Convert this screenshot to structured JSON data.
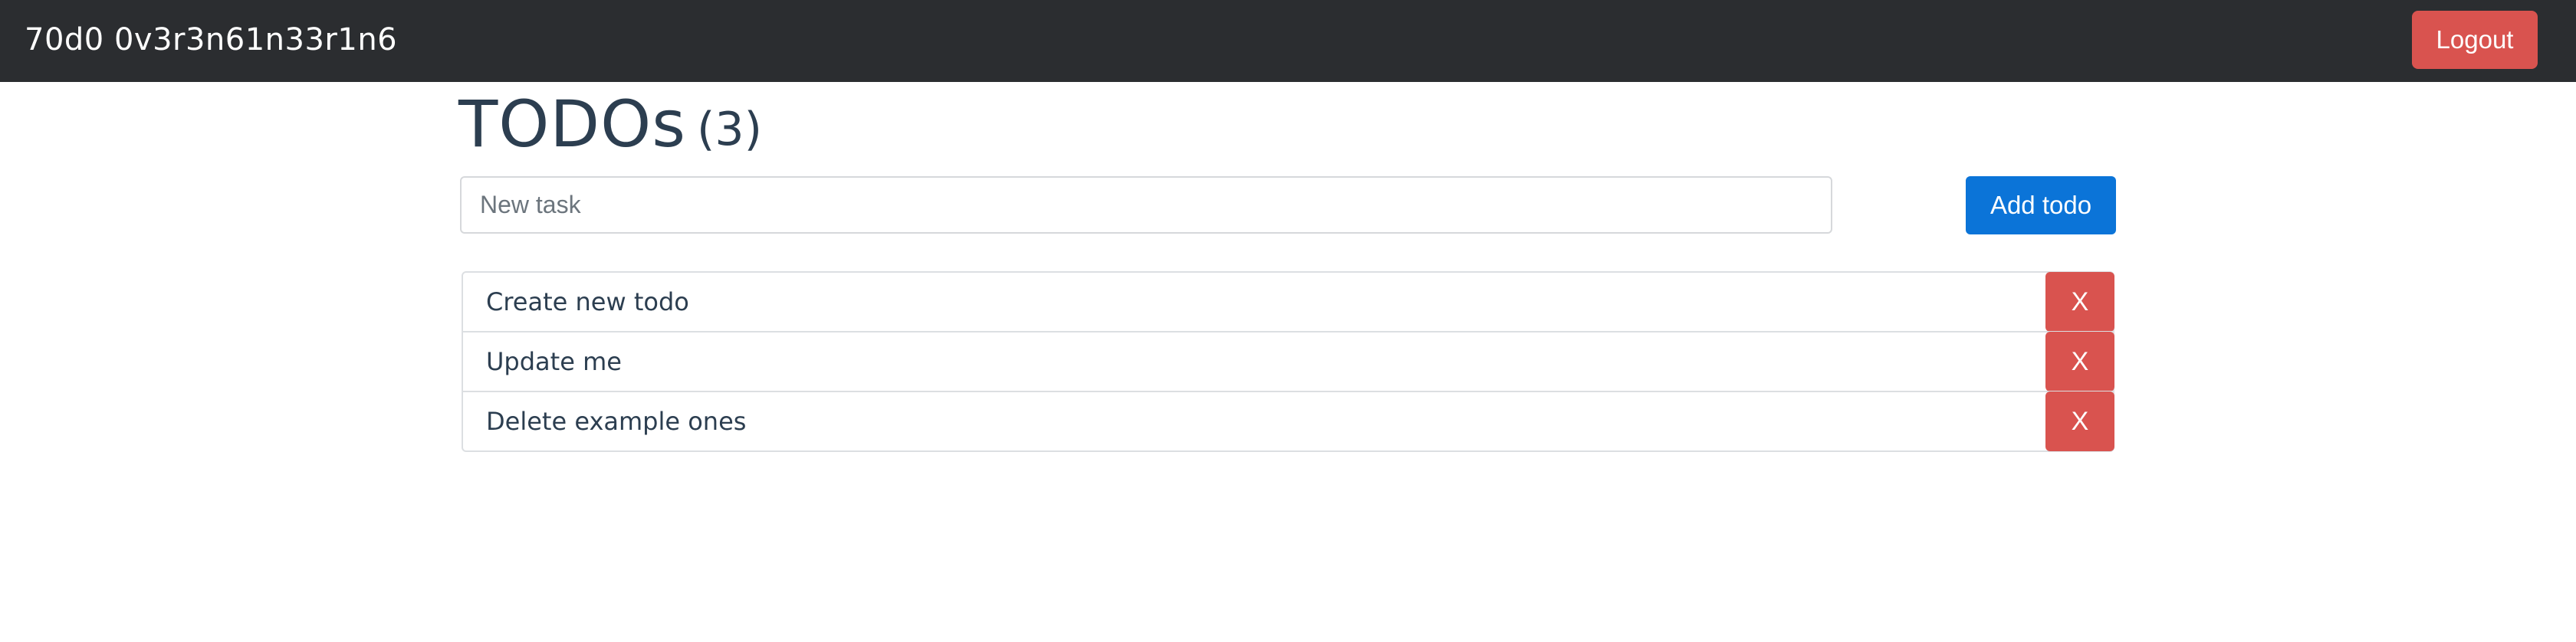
{
  "navbar": {
    "brand": "70d0 0v3r3n61n33r1n6",
    "logout_label": "Logout"
  },
  "header": {
    "title": "TODOs",
    "count": "(3)"
  },
  "form": {
    "placeholder": "New task",
    "value": "",
    "add_label": "Add todo"
  },
  "todos": [
    {
      "text": "Create new todo",
      "delete_label": "X"
    },
    {
      "text": "Update me",
      "delete_label": "X"
    },
    {
      "text": "Delete example ones",
      "delete_label": "X"
    }
  ],
  "colors": {
    "navbar_bg": "#2b2d30",
    "danger": "#d9534f",
    "primary": "#0b74d8",
    "text": "#2c3e50"
  }
}
